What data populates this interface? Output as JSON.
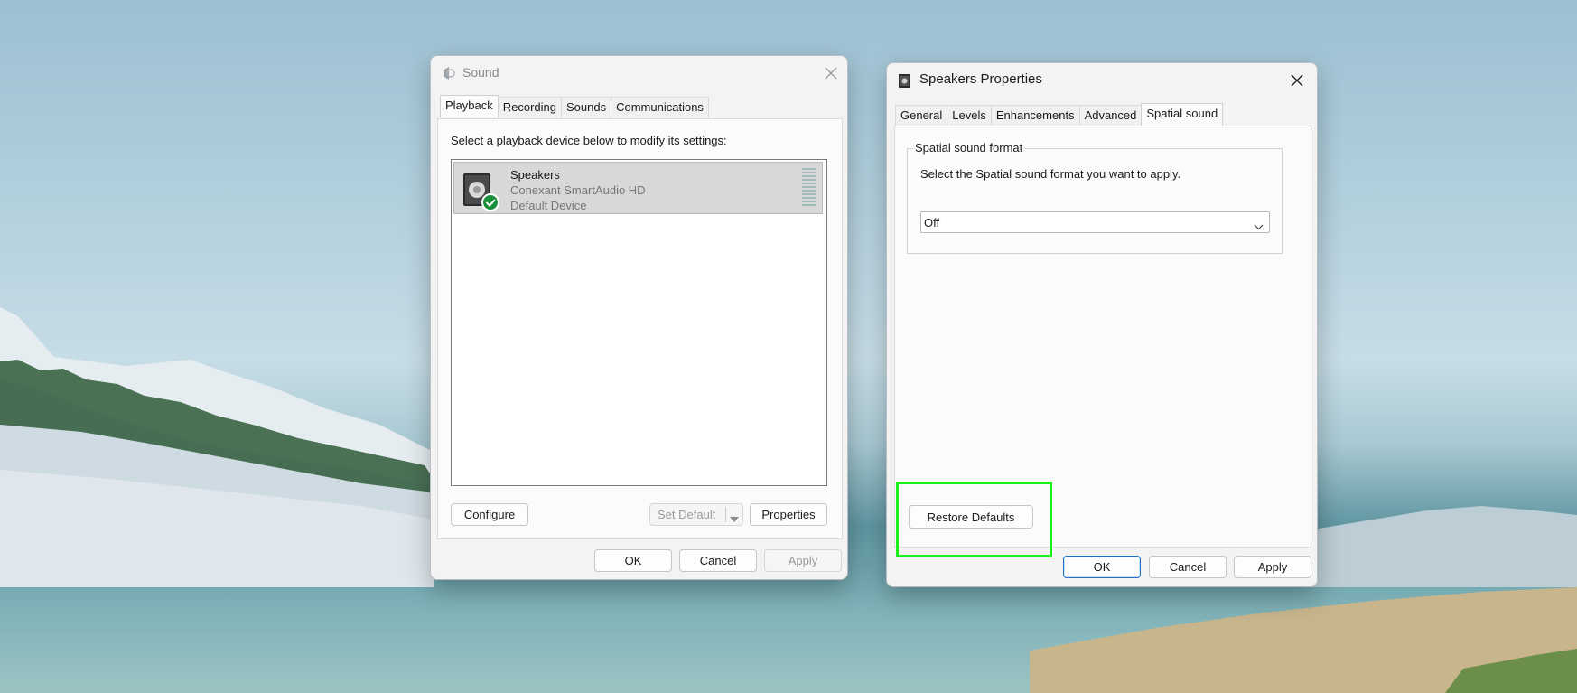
{
  "sound_window": {
    "title": "Sound",
    "tabs": [
      {
        "label": "Playback"
      },
      {
        "label": "Recording"
      },
      {
        "label": "Sounds"
      },
      {
        "label": "Communications"
      }
    ],
    "instruction": "Select a playback device below to modify its settings:",
    "device": {
      "name": "Speakers",
      "driver": "Conexant SmartAudio HD",
      "status": "Default Device"
    },
    "configure_label": "Configure",
    "set_default_label": "Set Default",
    "properties_label": "Properties",
    "ok_label": "OK",
    "cancel_label": "Cancel",
    "apply_label": "Apply"
  },
  "speakers_window": {
    "title": "Speakers Properties",
    "tabs": [
      {
        "label": "General"
      },
      {
        "label": "Levels"
      },
      {
        "label": "Enhancements"
      },
      {
        "label": "Advanced"
      },
      {
        "label": "Spatial sound"
      }
    ],
    "group_label": "Spatial sound format",
    "group_instruction": "Select the Spatial sound format you want to apply.",
    "format_value": "Off",
    "restore_defaults_label": "Restore Defaults",
    "ok_label": "OK",
    "cancel_label": "Cancel",
    "apply_label": "Apply"
  },
  "colors": {
    "highlight": "#1cf01c",
    "ok_border": "#1e6fbf",
    "default_check": "#1a8f3a"
  }
}
